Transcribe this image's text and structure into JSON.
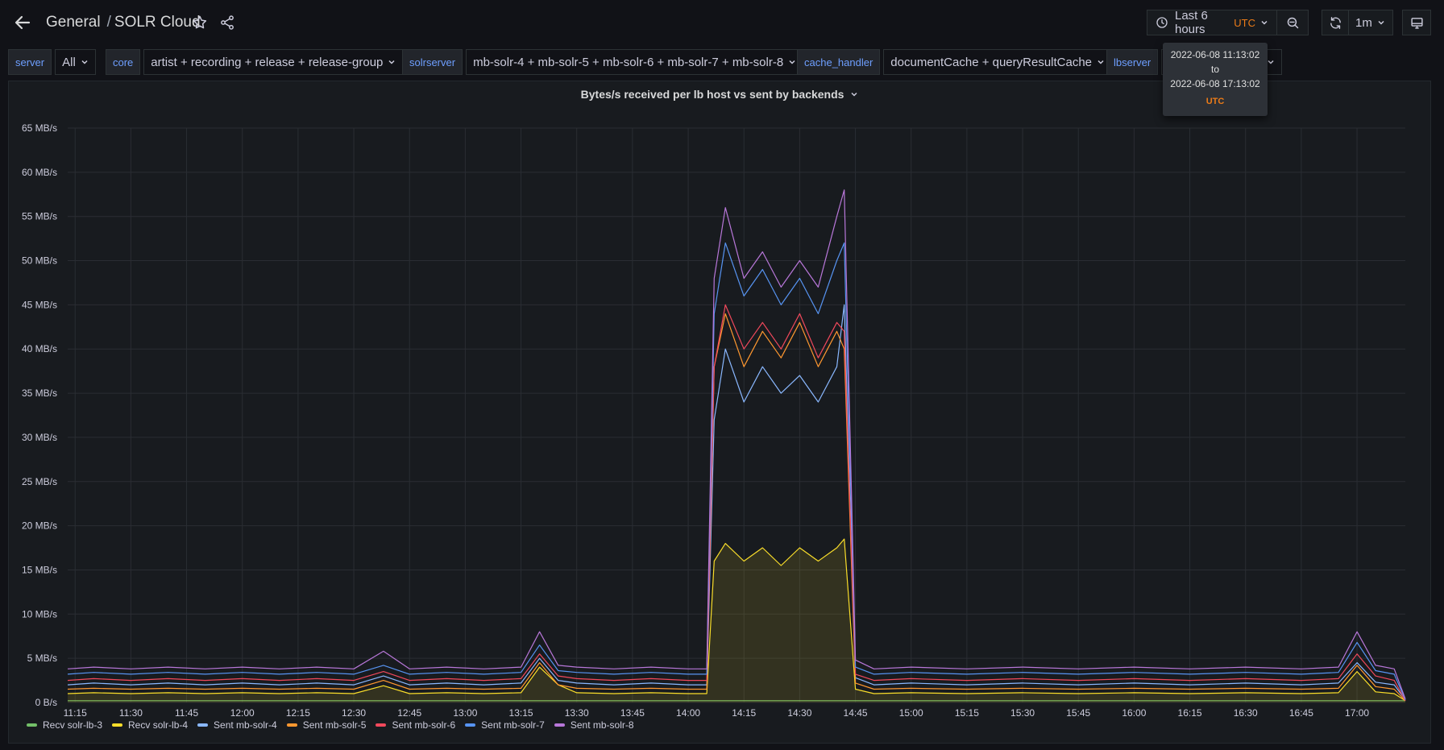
{
  "header": {
    "folder": "General",
    "dashboard": "SOLR Cloud"
  },
  "time_picker": {
    "range_label": "Last 6 hours",
    "timezone": "UTC",
    "refresh_interval": "1m",
    "tooltip": {
      "from": "2022-06-08 11:13:02",
      "to_word": "to",
      "to": "2022-06-08 17:13:02",
      "timezone": "UTC"
    }
  },
  "variables": [
    {
      "label": "server",
      "value": "All"
    },
    {
      "label": "core",
      "value": "artist + recording + release + release-group"
    },
    {
      "label": "solrserver",
      "value": "mb-solr-4 + mb-solr-5 + mb-solr-6 + mb-solr-7 + mb-solr-8"
    },
    {
      "label": "cache_handler",
      "value": "documentCache + queryResultCache"
    },
    {
      "label": "lbserver",
      "value": ""
    }
  ],
  "panel": {
    "title": "Bytes/s received per lb host vs sent by backends"
  },
  "colors": {
    "background": "#111217",
    "panel": "#181b1f",
    "grid": "#2a2d33",
    "accent": "#eb7b18",
    "variable_label": "#6e9fff"
  },
  "chart_data": {
    "type": "line",
    "title": "Bytes/s received per lb host vs sent by backends",
    "x_unit": "time (UTC)",
    "y_unit": "MB/s",
    "ylim": [
      0,
      65
    ],
    "y_ticks": [
      "0 B/s",
      "5 MB/s",
      "10 MB/s",
      "15 MB/s",
      "20 MB/s",
      "25 MB/s",
      "30 MB/s",
      "35 MB/s",
      "40 MB/s",
      "45 MB/s",
      "50 MB/s",
      "55 MB/s",
      "60 MB/s",
      "65 MB/s"
    ],
    "x_ticks": [
      "11:15",
      "11:30",
      "11:45",
      "12:00",
      "12:15",
      "12:30",
      "12:45",
      "13:00",
      "13:15",
      "13:30",
      "13:45",
      "14:00",
      "14:15",
      "14:30",
      "14:45",
      "15:00",
      "15:15",
      "15:30",
      "15:45",
      "16:00",
      "16:15",
      "16:30",
      "16:45",
      "17:00"
    ],
    "grid": true,
    "legend_position": "bottom-left",
    "x": [
      "11:13",
      "11:20",
      "11:30",
      "11:40",
      "11:50",
      "12:00",
      "12:10",
      "12:20",
      "12:30",
      "12:38",
      "12:45",
      "12:55",
      "13:05",
      "13:15",
      "13:20",
      "13:25",
      "13:30",
      "13:40",
      "13:50",
      "14:00",
      "14:05",
      "14:07",
      "14:10",
      "14:15",
      "14:20",
      "14:25",
      "14:30",
      "14:35",
      "14:40",
      "14:42",
      "14:45",
      "14:50",
      "15:00",
      "15:15",
      "15:30",
      "15:45",
      "16:00",
      "16:15",
      "16:30",
      "16:45",
      "16:55",
      "17:00",
      "17:05",
      "17:10",
      "17:13"
    ],
    "series": [
      {
        "name": "Recv solr-lb-3",
        "color": "#73bf69",
        "fill": false,
        "values": [
          0.2,
          0.2,
          0.2,
          0.2,
          0.2,
          0.2,
          0.2,
          0.2,
          0.2,
          0.2,
          0.2,
          0.2,
          0.2,
          0.2,
          0.2,
          0.2,
          0.2,
          0.2,
          0.2,
          0.2,
          0.2,
          0.2,
          0.2,
          0.2,
          0.2,
          0.2,
          0.2,
          0.2,
          0.2,
          0.2,
          0.2,
          0.2,
          0.2,
          0.2,
          0.2,
          0.2,
          0.2,
          0.2,
          0.2,
          0.2,
          0.2,
          0.2,
          0.2,
          0.2,
          0.2
        ]
      },
      {
        "name": "Recv solr-lb-4",
        "color": "#fade2a",
        "fill": true,
        "values": [
          1.0,
          1.1,
          1.0,
          1.1,
          1.0,
          1.1,
          1.0,
          1.1,
          1.0,
          1.9,
          1.0,
          1.1,
          1.0,
          1.1,
          4.0,
          2.0,
          1.1,
          1.0,
          1.1,
          1.0,
          1.0,
          16.0,
          18.0,
          16.0,
          17.5,
          15.5,
          17.5,
          16.0,
          17.5,
          18.5,
          1.5,
          1.0,
          1.1,
          1.0,
          1.1,
          1.0,
          1.1,
          1.0,
          1.1,
          1.0,
          1.1,
          3.5,
          1.2,
          1.0,
          0.2
        ]
      },
      {
        "name": "Sent mb-solr-4",
        "color": "#8ab8ff",
        "fill": false,
        "values": [
          2.0,
          2.2,
          2.0,
          2.2,
          2.0,
          2.2,
          2.0,
          2.2,
          2.0,
          3.0,
          2.0,
          2.2,
          2.0,
          2.2,
          5.0,
          2.5,
          2.2,
          2.0,
          2.2,
          2.0,
          2.0,
          32.0,
          40.0,
          34.0,
          38.0,
          35.0,
          37.0,
          34.0,
          38.0,
          45.0,
          2.8,
          2.0,
          2.2,
          2.0,
          2.2,
          2.0,
          2.2,
          2.0,
          2.2,
          2.0,
          2.2,
          4.5,
          2.3,
          2.0,
          0.3
        ]
      },
      {
        "name": "Sent mb-solr-5",
        "color": "#ff9830",
        "fill": false,
        "values": [
          1.5,
          1.6,
          1.5,
          1.6,
          1.5,
          1.6,
          1.5,
          1.6,
          1.5,
          2.5,
          1.5,
          1.6,
          1.5,
          1.6,
          4.5,
          2.0,
          1.6,
          1.5,
          1.6,
          1.5,
          1.5,
          38.0,
          44.0,
          38.0,
          42.0,
          39.0,
          43.0,
          38.0,
          42.0,
          40.0,
          2.2,
          1.5,
          1.6,
          1.5,
          1.6,
          1.5,
          1.6,
          1.5,
          1.6,
          1.5,
          1.6,
          4.2,
          1.8,
          1.5,
          0.2
        ]
      },
      {
        "name": "Sent mb-solr-6",
        "color": "#f2495c",
        "fill": false,
        "values": [
          2.5,
          2.7,
          2.5,
          2.7,
          2.5,
          2.7,
          2.5,
          2.7,
          2.5,
          3.5,
          2.5,
          2.7,
          2.5,
          2.7,
          5.5,
          3.0,
          2.7,
          2.5,
          2.7,
          2.5,
          2.5,
          38.0,
          45.0,
          40.0,
          43.0,
          40.0,
          44.0,
          39.0,
          43.0,
          42.0,
          3.2,
          2.5,
          2.7,
          2.5,
          2.7,
          2.5,
          2.7,
          2.5,
          2.7,
          2.5,
          2.7,
          5.5,
          3.0,
          2.5,
          0.2
        ]
      },
      {
        "name": "Sent mb-solr-7",
        "color": "#5794f2",
        "fill": false,
        "values": [
          3.2,
          3.4,
          3.2,
          3.4,
          3.2,
          3.4,
          3.2,
          3.4,
          3.2,
          4.2,
          3.2,
          3.4,
          3.2,
          3.4,
          6.5,
          3.6,
          3.4,
          3.2,
          3.4,
          3.2,
          3.2,
          44.0,
          52.0,
          46.0,
          49.0,
          45.0,
          48.0,
          44.0,
          50.0,
          52.0,
          4.0,
          3.2,
          3.4,
          3.2,
          3.4,
          3.2,
          3.4,
          3.2,
          3.4,
          3.2,
          3.4,
          6.8,
          3.6,
          3.2,
          0.3
        ]
      },
      {
        "name": "Sent mb-solr-8",
        "color": "#b877d9",
        "fill": false,
        "values": [
          3.8,
          4.0,
          3.8,
          4.0,
          3.8,
          4.0,
          3.8,
          4.0,
          3.8,
          5.8,
          3.8,
          4.0,
          3.8,
          4.0,
          8.0,
          4.2,
          4.0,
          3.8,
          4.0,
          3.8,
          3.8,
          48.0,
          56.0,
          48.0,
          51.0,
          47.0,
          50.0,
          47.0,
          55.0,
          58.0,
          4.8,
          3.8,
          4.0,
          3.8,
          4.0,
          3.8,
          4.0,
          3.8,
          4.0,
          3.8,
          4.0,
          8.0,
          4.2,
          3.8,
          0.4
        ]
      }
    ]
  }
}
